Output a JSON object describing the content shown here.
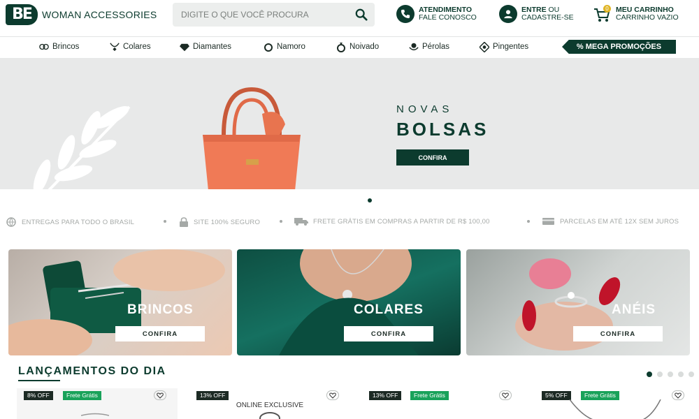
{
  "header": {
    "logo_mark": "BE",
    "brand": "WOMAN ACCESSORIES",
    "search_placeholder": "DIGITE O QUE VOCÊ PROCURA",
    "support_title": "ATENDIMENTO",
    "support_sub": "FALE CONOSCO",
    "login_title": "ENTRE",
    "login_or": "OU",
    "login_sub": "CADASTRE-SE",
    "cart_title": "MEU CARRINHO",
    "cart_sub": "CARRINHO VAZIO",
    "cart_count": "0"
  },
  "nav": {
    "items": [
      "Brincos",
      "Colares",
      "Diamantes",
      "Namoro",
      "Noivado",
      "Pérolas",
      "Pingentes"
    ],
    "promo": "% MEGA PROMOÇÕES"
  },
  "hero": {
    "kicker": "NOVAS",
    "title": "BOLSAS",
    "button": "CONFIRA"
  },
  "benefits": [
    "ENTREGAS PARA TODO O BRASIL",
    "SITE 100% SEGURO",
    "FRETE GRÁTIS EM COMPRAS A PARTIR DE R$ 100,00",
    "PARCELAS EM ATÉ 12X SEM JUROS"
  ],
  "categories": [
    {
      "title": "BRINCOS",
      "button": "CONFIRA"
    },
    {
      "title": "COLARES",
      "button": "CONFIRA"
    },
    {
      "title": "ANÉIS",
      "button": "CONFIRA"
    }
  ],
  "launches": {
    "title": "LANÇAMENTOS DO DIA",
    "products": [
      {
        "discount": "8% OFF",
        "shipping": "Frete Grátis"
      },
      {
        "discount": "13% OFF",
        "shipping": "",
        "tag": "ONLINE EXCLUSIVE"
      },
      {
        "discount": "13% OFF",
        "shipping": "Frete Grátis"
      },
      {
        "discount": "5% OFF",
        "shipping": "Frete Grátis"
      }
    ]
  },
  "colors": {
    "brand_green": "#0c3b2e",
    "free_shipping_green": "#19a25a",
    "hero_bag": "#f07a56"
  }
}
